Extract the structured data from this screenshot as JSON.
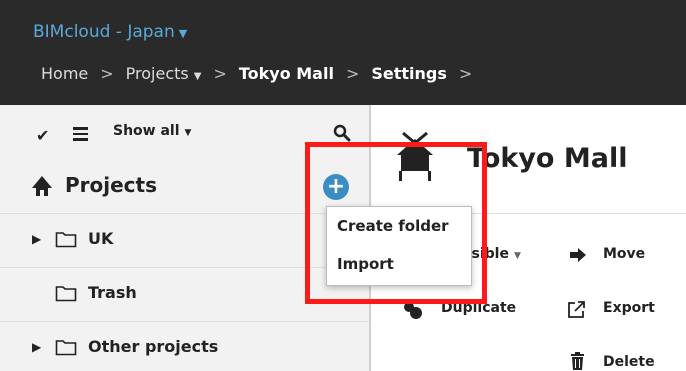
{
  "header": {
    "app_title": "BIMcloud - Japan",
    "breadcrumb": {
      "home": "Home",
      "projects": "Projects",
      "current": "Tokyo Mall",
      "settings": "Settings",
      "sep": ">"
    }
  },
  "sidebar": {
    "filter_label": "Show all",
    "title": "Projects",
    "items": [
      {
        "label": "UK"
      },
      {
        "label": "Trash"
      },
      {
        "label": "Other projects"
      }
    ]
  },
  "dropdown": {
    "items": [
      {
        "label": "Create folder"
      },
      {
        "label": "Import"
      }
    ]
  },
  "main": {
    "title": "Tokyo Mall",
    "actions": {
      "access": "esible",
      "move": "Move",
      "duplicate": "Duplicate",
      "export": "Export",
      "delete": "Delete"
    }
  },
  "colors": {
    "topbar": "#2a2a2a",
    "app_title": "#5aa9d6",
    "accent": "#3a8dc4",
    "highlight": "#ff1a1a"
  }
}
